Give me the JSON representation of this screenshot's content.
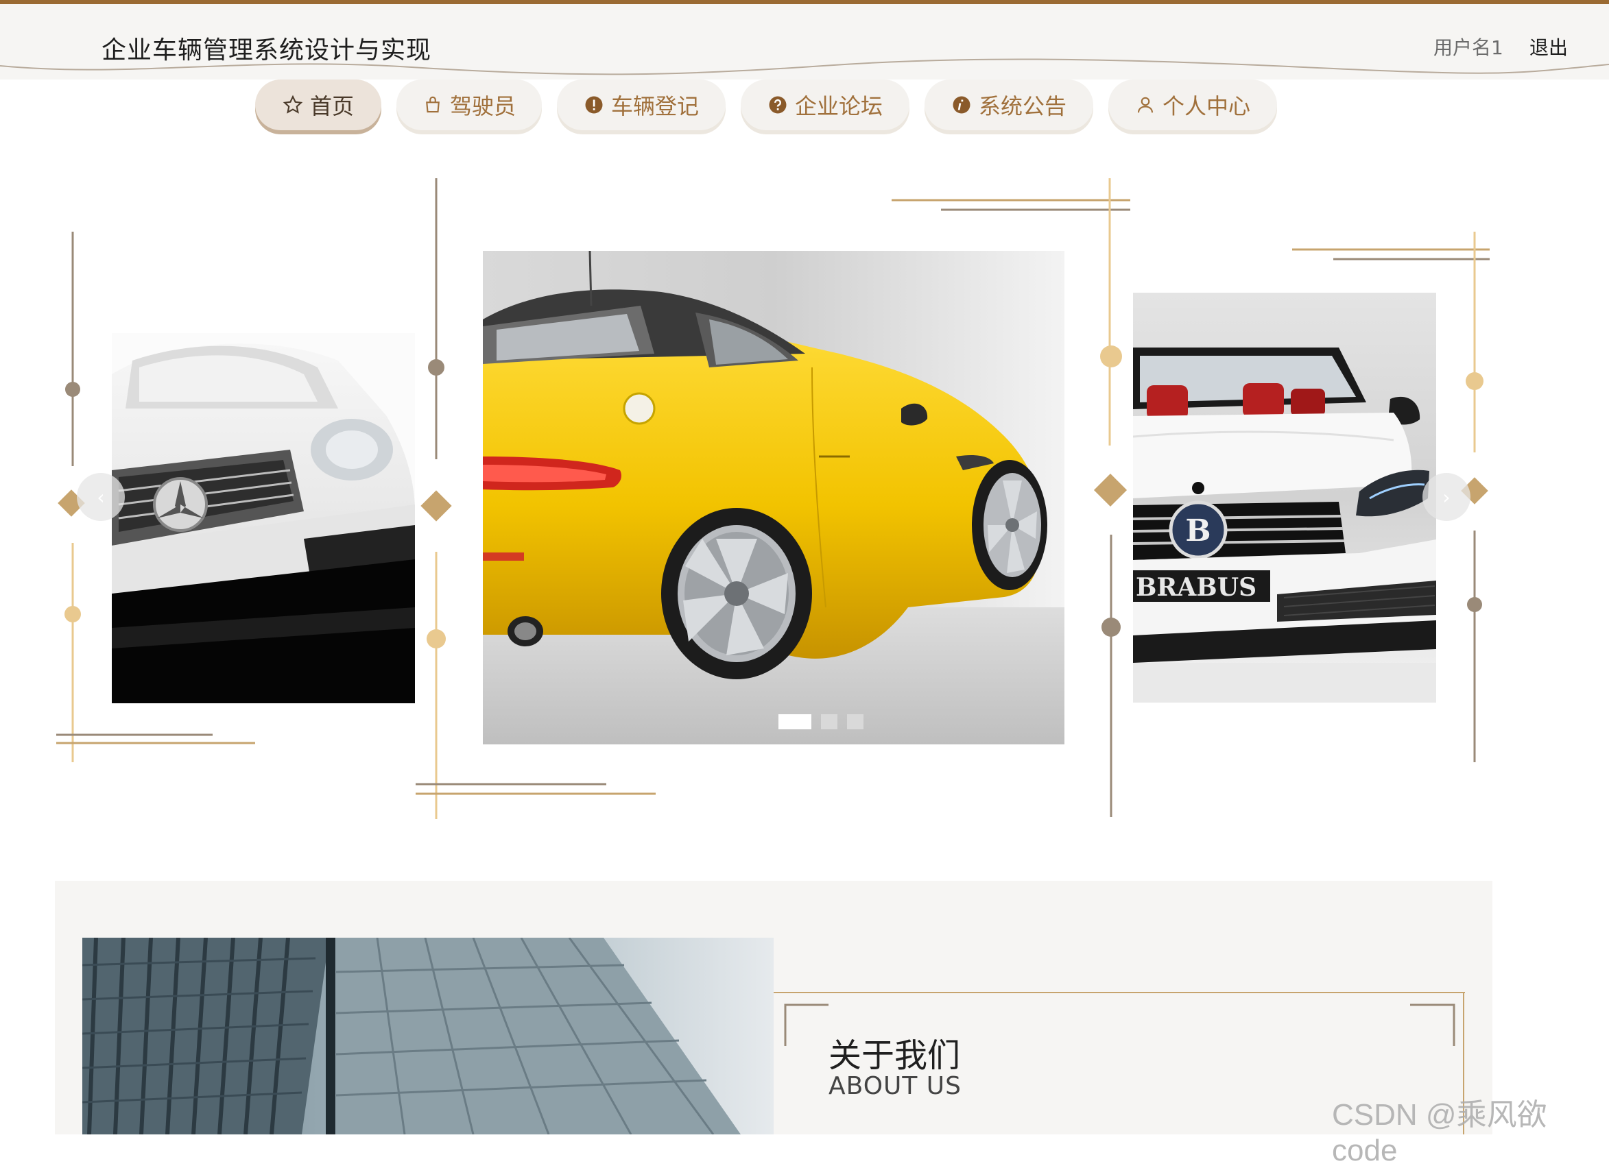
{
  "header": {
    "title": "企业车辆管理系统设计与实现",
    "user_name": "用户名1",
    "logout_label": "退出"
  },
  "nav": {
    "items": [
      {
        "label": "首页",
        "icon": "star-icon",
        "active": true
      },
      {
        "label": "驾驶员",
        "icon": "bag-icon",
        "active": false
      },
      {
        "label": "车辆登记",
        "icon": "alert-icon",
        "active": false
      },
      {
        "label": "企业论坛",
        "icon": "question-icon",
        "active": false
      },
      {
        "label": "系统公告",
        "icon": "info-icon",
        "active": false
      },
      {
        "label": "个人中心",
        "icon": "user-icon",
        "active": false
      }
    ]
  },
  "carousel": {
    "prev_label": "‹",
    "next_label": "›",
    "slides": [
      {
        "subject": "silver-sports-car"
      },
      {
        "subject": "yellow-sports-car"
      },
      {
        "subject": "white-convertible",
        "badge_text": "BRABUS"
      }
    ],
    "dot_count": 3,
    "active_dot": 0
  },
  "about": {
    "title": "关于我们",
    "subtitle": "ABOUT US"
  },
  "watermark": "CSDN @乘风欲code",
  "colors": {
    "accent": "#9a6a32",
    "nav_text": "#a0703b",
    "gold": "#c7a46e",
    "taupe": "#9a8a78",
    "light_gold": "#e9c98f"
  }
}
